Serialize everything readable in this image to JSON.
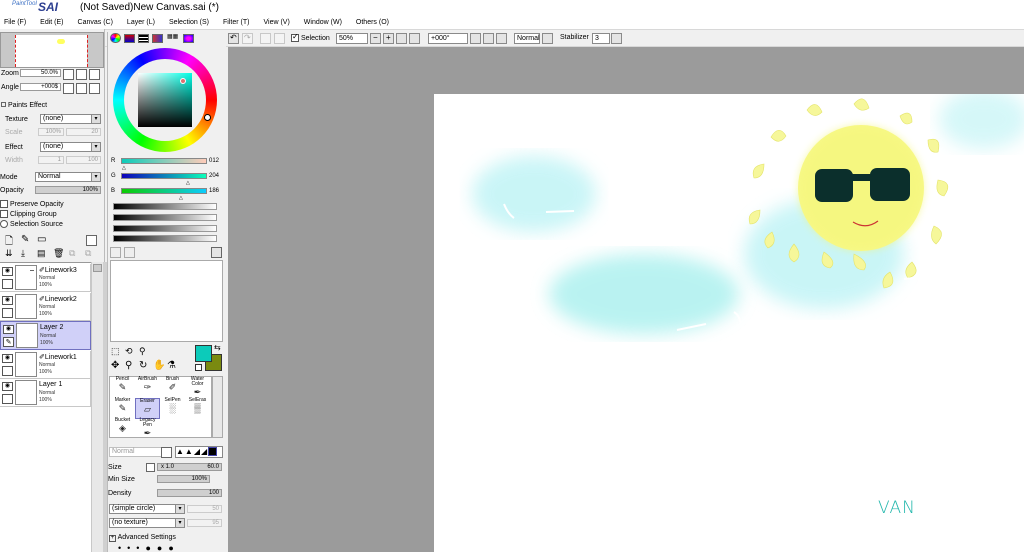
{
  "title": {
    "logo_small": "PaintTool",
    "logo_big": "SAI",
    "window_title": "(Not Saved)New Canvas.sai (*)"
  },
  "menu": [
    {
      "label": "File (F)"
    },
    {
      "label": "Edit (E)"
    },
    {
      "label": "Canvas (C)"
    },
    {
      "label": "Layer (L)"
    },
    {
      "label": "Selection (S)"
    },
    {
      "label": "Filter (T)"
    },
    {
      "label": "View (V)"
    },
    {
      "label": "Window (W)"
    },
    {
      "label": "Others (O)"
    }
  ],
  "toolbar": {
    "selection_label": "Selection",
    "selection_checked": true,
    "zoom_value": "50%",
    "angle_value": "+000°",
    "blend_value": "Normal",
    "stabilizer_label": "Stabilizer",
    "stabilizer_value": "3"
  },
  "navigator": {
    "zoom_label": "Zoom",
    "zoom_value": "50.0%",
    "angle_label": "Angle",
    "angle_value": "+000$"
  },
  "paints_effect": {
    "header": "Paints Effect",
    "texture_label": "Texture",
    "texture_value": "(none)",
    "scale_label": "Scale",
    "scale_value": "100%",
    "scale_num": "20",
    "effect_label": "Effect",
    "effect_value": "(none)",
    "width_label": "Width",
    "width_value": "1",
    "width_num": "100"
  },
  "layer_props": {
    "mode_label": "Mode",
    "mode_value": "Normal",
    "opacity_label": "Opacity",
    "opacity_value": "100%",
    "preserve_opacity": "Preserve Opacity",
    "clipping_group": "Clipping Group",
    "selection_source": "Selection Source"
  },
  "layers": [
    {
      "name": "Linework3",
      "blend": "Normal",
      "opacity": "100%",
      "selected": false,
      "linework": true
    },
    {
      "name": "Linework2",
      "blend": "Normal",
      "opacity": "100%",
      "selected": false,
      "linework": true
    },
    {
      "name": "Layer 2",
      "blend": "Normal",
      "opacity": "100%",
      "selected": true,
      "linework": false
    },
    {
      "name": "Linework1",
      "blend": "Normal",
      "opacity": "100%",
      "selected": false,
      "linework": true
    },
    {
      "name": "Layer 1",
      "blend": "Normal",
      "opacity": "100%",
      "selected": false,
      "linework": false
    }
  ],
  "color": {
    "r_label": "R",
    "r_value": "012",
    "g_label": "G",
    "g_value": "204",
    "b_label": "B",
    "b_value": "186",
    "primary": "#0ccbba",
    "secondary": "#7a8a10"
  },
  "tools": [
    {
      "label": "Pencil",
      "icon": "pencil-icon",
      "glyph": "✎",
      "selected": false
    },
    {
      "label": "AirBrush",
      "icon": "airbrush-icon",
      "glyph": "✑",
      "selected": false
    },
    {
      "label": "Brush",
      "icon": "brush-icon",
      "glyph": "✐",
      "selected": false
    },
    {
      "label": "Water Color",
      "icon": "watercolor-icon",
      "glyph": "✒",
      "selected": false
    },
    {
      "label": "Marker",
      "icon": "marker-icon",
      "glyph": "✎",
      "selected": false
    },
    {
      "label": "Eraser",
      "icon": "eraser-icon",
      "glyph": "▱",
      "selected": true
    },
    {
      "label": "SelPen",
      "icon": "selpen-icon",
      "glyph": "░",
      "selected": false
    },
    {
      "label": "SelEras",
      "icon": "seleras-icon",
      "glyph": "▒",
      "selected": false
    },
    {
      "label": "Bucket",
      "icon": "bucket-icon",
      "glyph": "◈",
      "selected": false
    },
    {
      "label": "Legacy Pen",
      "icon": "legacy-pen-icon",
      "glyph": "✒",
      "selected": false
    }
  ],
  "brush": {
    "blend_value": "Normal",
    "size_label": "Size",
    "size_mult": "x 1.0",
    "size_value": "60.0",
    "minsize_label": "Min Size",
    "minsize_value": "100%",
    "density_label": "Density",
    "density_value": "100",
    "shape_value": "(simple circle)",
    "shape_num": "50",
    "texture_value": "(no texture)",
    "texture_num": "95",
    "advanced_label": "Advanced Settings"
  },
  "artwork": {
    "signature": "VAN"
  }
}
